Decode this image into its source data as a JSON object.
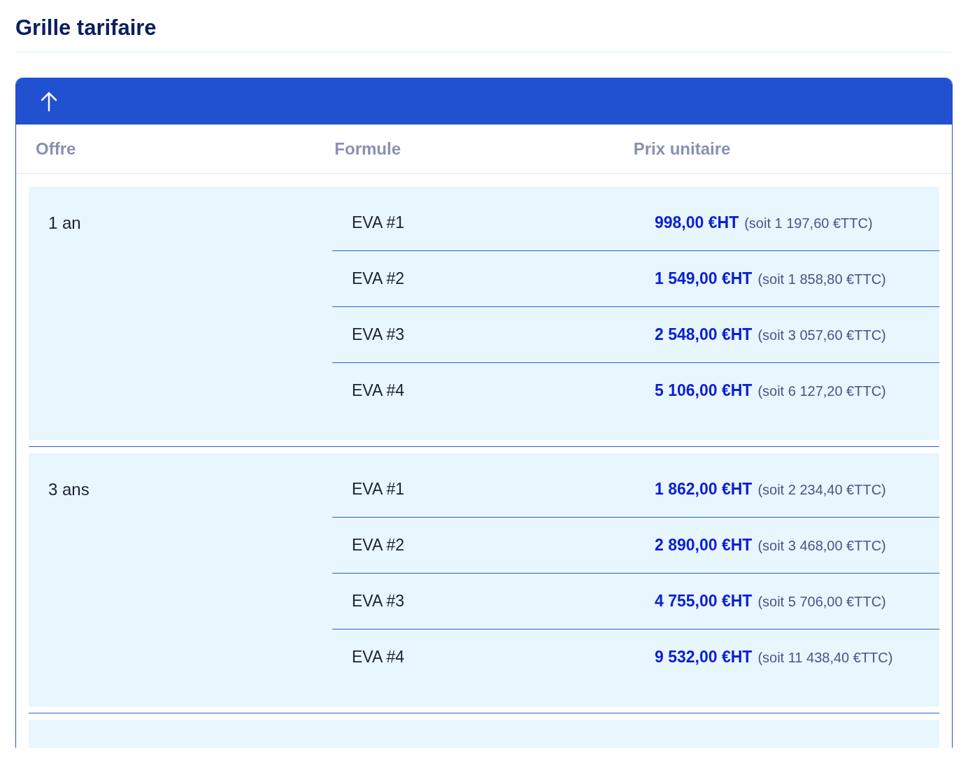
{
  "title": "Grille tarifaire",
  "table": {
    "columns": [
      "Offre",
      "Formule",
      "Prix unitaire"
    ],
    "groups": [
      {
        "offer": "1 an",
        "rows": [
          {
            "formula": "EVA #1",
            "price_ht": "998,00 €HT",
            "price_ttc": "(soit 1 197,60 €TTC)"
          },
          {
            "formula": "EVA #2",
            "price_ht": "1 549,00 €HT",
            "price_ttc": "(soit 1 858,80 €TTC)"
          },
          {
            "formula": "EVA #3",
            "price_ht": "2 548,00 €HT",
            "price_ttc": "(soit 3 057,60 €TTC)"
          },
          {
            "formula": "EVA #4",
            "price_ht": "5 106,00 €HT",
            "price_ttc": "(soit 6 127,20 €TTC)"
          }
        ]
      },
      {
        "offer": "3 ans",
        "rows": [
          {
            "formula": "EVA #1",
            "price_ht": "1 862,00 €HT",
            "price_ttc": "(soit 2 234,40 €TTC)"
          },
          {
            "formula": "EVA #2",
            "price_ht": "2 890,00 €HT",
            "price_ttc": "(soit 3 468,00 €TTC)"
          },
          {
            "formula": "EVA #3",
            "price_ht": "4 755,00 €HT",
            "price_ttc": "(soit 5 706,00 €TTC)"
          },
          {
            "formula": "EVA #4",
            "price_ht": "9 532,00 €HT",
            "price_ttc": "(soit 11 438,40 €TTC)"
          }
        ]
      }
    ]
  }
}
